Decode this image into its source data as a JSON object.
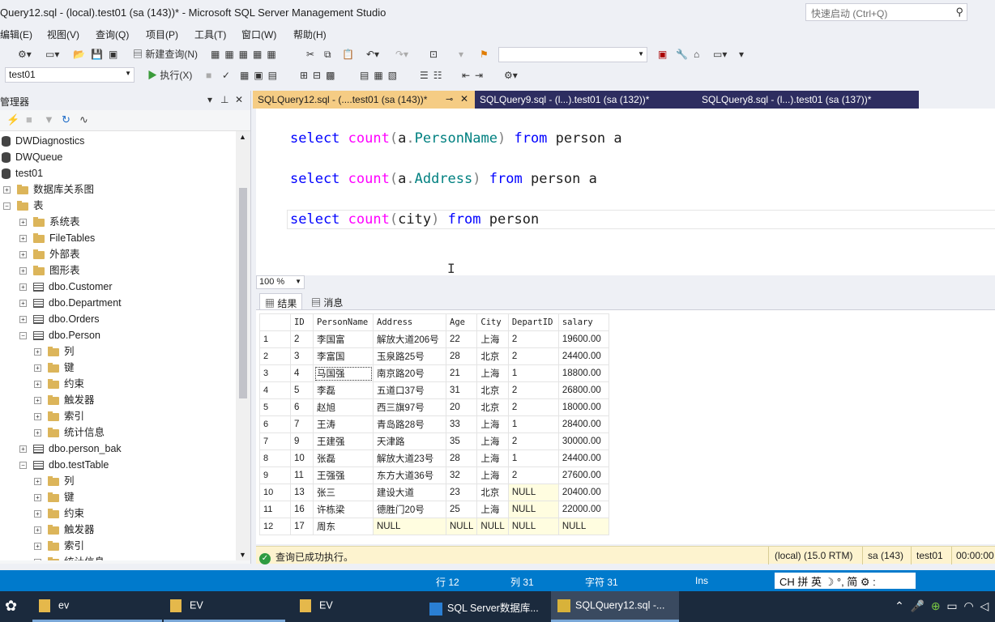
{
  "window": {
    "title": "Query12.sql - (local).test01 (sa (143))* - Microsoft SQL Server Management Studio",
    "quick_launch_placeholder": "快速启动 (Ctrl+Q)"
  },
  "menu": [
    "编辑(E)",
    "视图(V)",
    "查询(Q)",
    "项目(P)",
    "工具(T)",
    "窗口(W)",
    "帮助(H)"
  ],
  "toolbar": {
    "new_query": "新建查询(N)",
    "execute": "执行(X)",
    "database": "test01"
  },
  "object_explorer": {
    "title": "管理器",
    "nodes": [
      {
        "label": "DWDiagnostics",
        "icon": "database-icon",
        "level": 0
      },
      {
        "label": "DWQueue",
        "icon": "database-icon",
        "level": 0
      },
      {
        "label": "test01",
        "icon": "database-icon",
        "level": 0
      },
      {
        "label": "数据库关系图",
        "icon": "folder-icon",
        "level": 1,
        "exp": "+"
      },
      {
        "label": "表",
        "icon": "folder-icon",
        "level": 1,
        "exp": "−"
      },
      {
        "label": "系统表",
        "icon": "folder-icon",
        "level": 2,
        "exp": "+"
      },
      {
        "label": "FileTables",
        "icon": "folder-icon",
        "level": 2,
        "exp": "+"
      },
      {
        "label": "外部表",
        "icon": "folder-icon",
        "level": 2,
        "exp": "+"
      },
      {
        "label": "图形表",
        "icon": "folder-icon",
        "level": 2,
        "exp": "+"
      },
      {
        "label": "dbo.Customer",
        "icon": "table-icon",
        "level": 2,
        "exp": "+"
      },
      {
        "label": "dbo.Department",
        "icon": "table-icon",
        "level": 2,
        "exp": "+"
      },
      {
        "label": "dbo.Orders",
        "icon": "table-icon",
        "level": 2,
        "exp": "+"
      },
      {
        "label": "dbo.Person",
        "icon": "table-icon",
        "level": 2,
        "exp": "−"
      },
      {
        "label": "列",
        "icon": "folder-icon",
        "level": 3,
        "exp": "+"
      },
      {
        "label": "键",
        "icon": "folder-icon",
        "level": 3,
        "exp": "+"
      },
      {
        "label": "约束",
        "icon": "folder-icon",
        "level": 3,
        "exp": "+"
      },
      {
        "label": "触发器",
        "icon": "folder-icon",
        "level": 3,
        "exp": "+"
      },
      {
        "label": "索引",
        "icon": "folder-icon",
        "level": 3,
        "exp": "+"
      },
      {
        "label": "统计信息",
        "icon": "folder-icon",
        "level": 3,
        "exp": "+"
      },
      {
        "label": "dbo.person_bak",
        "icon": "table-icon",
        "level": 2,
        "exp": "+"
      },
      {
        "label": "dbo.testTable",
        "icon": "table-icon",
        "level": 2,
        "exp": "−"
      },
      {
        "label": "列",
        "icon": "folder-icon",
        "level": 3,
        "exp": "+"
      },
      {
        "label": "键",
        "icon": "folder-icon",
        "level": 3,
        "exp": "+"
      },
      {
        "label": "约束",
        "icon": "folder-icon",
        "level": 3,
        "exp": "+"
      },
      {
        "label": "触发器",
        "icon": "folder-icon",
        "level": 3,
        "exp": "+"
      },
      {
        "label": "索引",
        "icon": "folder-icon",
        "level": 3,
        "exp": "+"
      },
      {
        "label": "统计信息",
        "icon": "folder-icon",
        "level": 3,
        "exp": "+"
      }
    ]
  },
  "tabs": [
    {
      "label": "SQLQuery12.sql - (....test01 (sa (143))*",
      "active": true
    },
    {
      "label": "SQLQuery9.sql - (l...).test01 (sa (132))*",
      "active": false
    },
    {
      "label": "SQLQuery8.sql - (l...).test01 (sa (137))*",
      "active": false
    }
  ],
  "editor": {
    "line1": {
      "k1": "select",
      "f": "count",
      "p1": "(",
      "a": "a",
      "dot": ".",
      "col": "PersonName",
      "p2": ")",
      "k2": "from",
      "rest": "person a"
    },
    "line2": {
      "k1": "select",
      "f": "count",
      "p1": "(",
      "a": "a",
      "dot": ".",
      "col": "Address",
      "p2": ")",
      "k2": "from",
      "rest": "person a"
    },
    "line3": {
      "k1": "select",
      "f": "count",
      "p1": "(",
      "col": "city",
      "p2": ")",
      "k2": "from",
      "rest": "person"
    }
  },
  "zoom": "100 %",
  "result_tabs": {
    "results": "结果",
    "messages": "消息"
  },
  "grid": {
    "columns": [
      "ID",
      "PersonName",
      "Address",
      "Age",
      "City",
      "DepartID",
      "salary"
    ],
    "rows": [
      [
        "1",
        "2",
        "李国富",
        "解放大道206号",
        "22",
        "上海",
        "2",
        "19600.00"
      ],
      [
        "2",
        "3",
        "李富国",
        "玉泉路25号",
        "28",
        "北京",
        "2",
        "24400.00"
      ],
      [
        "3",
        "4",
        "马国强",
        "南京路20号",
        "21",
        "上海",
        "1",
        "18800.00"
      ],
      [
        "4",
        "5",
        "李磊",
        "五道口37号",
        "31",
        "北京",
        "2",
        "26800.00"
      ],
      [
        "5",
        "6",
        "赵旭",
        "西三旗97号",
        "20",
        "北京",
        "2",
        "18000.00"
      ],
      [
        "6",
        "7",
        "王涛",
        "青岛路28号",
        "33",
        "上海",
        "1",
        "28400.00"
      ],
      [
        "7",
        "9",
        "王建强",
        "天津路",
        "35",
        "上海",
        "2",
        "30000.00"
      ],
      [
        "8",
        "10",
        "张磊",
        "解放大道23号",
        "28",
        "上海",
        "1",
        "24400.00"
      ],
      [
        "9",
        "11",
        "王强强",
        "东方大道36号",
        "32",
        "上海",
        "2",
        "27600.00"
      ],
      [
        "10",
        "13",
        "张三",
        "建设大道",
        "23",
        "北京",
        "NULL",
        "20400.00"
      ],
      [
        "11",
        "16",
        "许栋梁",
        "德胜门20号",
        "25",
        "上海",
        "NULL",
        "22000.00"
      ],
      [
        "12",
        "17",
        "周东",
        "NULL",
        "NULL",
        "NULL",
        "NULL",
        "NULL"
      ]
    ]
  },
  "query_status": {
    "message": "查询已成功执行。",
    "server": "(local) (15.0 RTM)",
    "user": "sa (143)",
    "db": "test01",
    "time": "00:00:00"
  },
  "statusbar": {
    "line": "行 12",
    "col": "列 31",
    "ch": "字符 31",
    "ins": "Ins",
    "ime": "CH 拼 英 ☽ °, 简 ⚙ :"
  },
  "taskbar": [
    {
      "label": "ev",
      "active": false
    },
    {
      "label": "EV",
      "active": false
    },
    {
      "label": "EV",
      "active": false
    },
    {
      "label": "SQL Server数据库...",
      "active": false
    },
    {
      "label": "SQLQuery12.sql -...",
      "active": true
    }
  ],
  "colors": {
    "accent": "#007acc",
    "tab_active": "#f5cc84",
    "tab_inactive": "#2d2d60",
    "keyword": "#0000ff",
    "function": "#ff00ff"
  }
}
